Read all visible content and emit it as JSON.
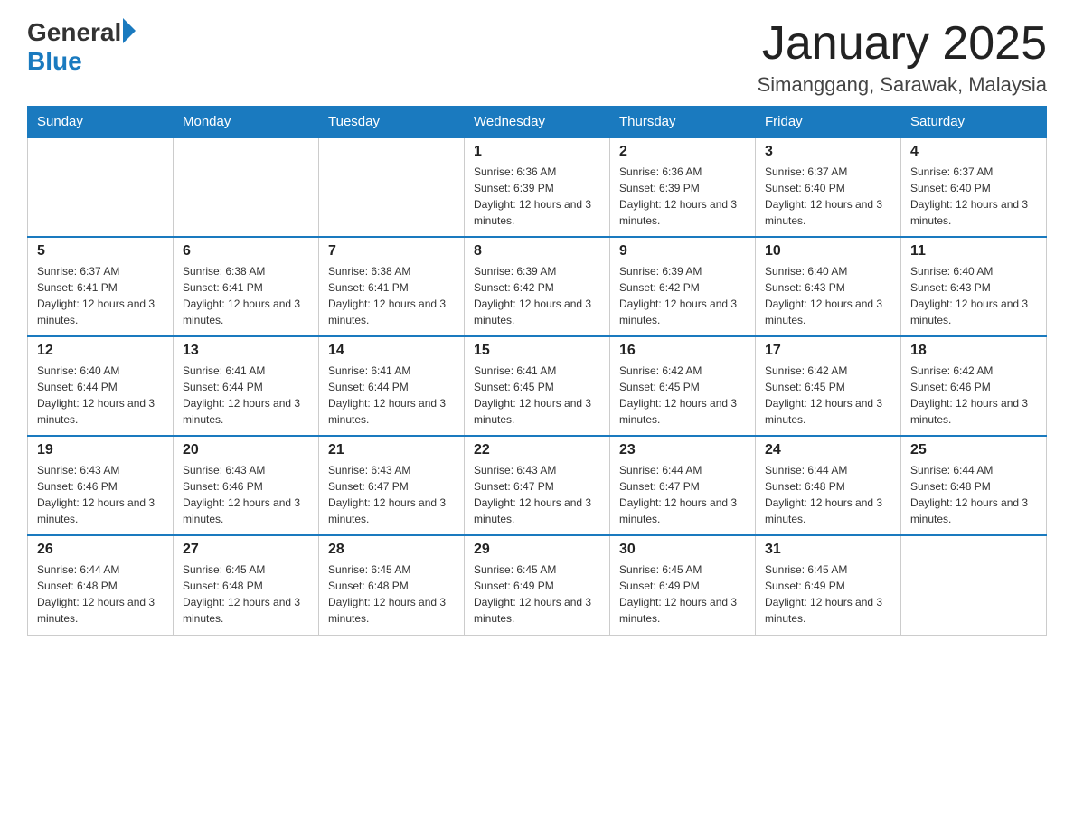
{
  "header": {
    "logo_general": "General",
    "logo_blue": "Blue",
    "title": "January 2025",
    "subtitle": "Simanggang, Sarawak, Malaysia"
  },
  "weekdays": [
    "Sunday",
    "Monday",
    "Tuesday",
    "Wednesday",
    "Thursday",
    "Friday",
    "Saturday"
  ],
  "weeks": [
    [
      {
        "day": "",
        "info": ""
      },
      {
        "day": "",
        "info": ""
      },
      {
        "day": "",
        "info": ""
      },
      {
        "day": "1",
        "info": "Sunrise: 6:36 AM\nSunset: 6:39 PM\nDaylight: 12 hours and 3 minutes."
      },
      {
        "day": "2",
        "info": "Sunrise: 6:36 AM\nSunset: 6:39 PM\nDaylight: 12 hours and 3 minutes."
      },
      {
        "day": "3",
        "info": "Sunrise: 6:37 AM\nSunset: 6:40 PM\nDaylight: 12 hours and 3 minutes."
      },
      {
        "day": "4",
        "info": "Sunrise: 6:37 AM\nSunset: 6:40 PM\nDaylight: 12 hours and 3 minutes."
      }
    ],
    [
      {
        "day": "5",
        "info": "Sunrise: 6:37 AM\nSunset: 6:41 PM\nDaylight: 12 hours and 3 minutes."
      },
      {
        "day": "6",
        "info": "Sunrise: 6:38 AM\nSunset: 6:41 PM\nDaylight: 12 hours and 3 minutes."
      },
      {
        "day": "7",
        "info": "Sunrise: 6:38 AM\nSunset: 6:41 PM\nDaylight: 12 hours and 3 minutes."
      },
      {
        "day": "8",
        "info": "Sunrise: 6:39 AM\nSunset: 6:42 PM\nDaylight: 12 hours and 3 minutes."
      },
      {
        "day": "9",
        "info": "Sunrise: 6:39 AM\nSunset: 6:42 PM\nDaylight: 12 hours and 3 minutes."
      },
      {
        "day": "10",
        "info": "Sunrise: 6:40 AM\nSunset: 6:43 PM\nDaylight: 12 hours and 3 minutes."
      },
      {
        "day": "11",
        "info": "Sunrise: 6:40 AM\nSunset: 6:43 PM\nDaylight: 12 hours and 3 minutes."
      }
    ],
    [
      {
        "day": "12",
        "info": "Sunrise: 6:40 AM\nSunset: 6:44 PM\nDaylight: 12 hours and 3 minutes."
      },
      {
        "day": "13",
        "info": "Sunrise: 6:41 AM\nSunset: 6:44 PM\nDaylight: 12 hours and 3 minutes."
      },
      {
        "day": "14",
        "info": "Sunrise: 6:41 AM\nSunset: 6:44 PM\nDaylight: 12 hours and 3 minutes."
      },
      {
        "day": "15",
        "info": "Sunrise: 6:41 AM\nSunset: 6:45 PM\nDaylight: 12 hours and 3 minutes."
      },
      {
        "day": "16",
        "info": "Sunrise: 6:42 AM\nSunset: 6:45 PM\nDaylight: 12 hours and 3 minutes."
      },
      {
        "day": "17",
        "info": "Sunrise: 6:42 AM\nSunset: 6:45 PM\nDaylight: 12 hours and 3 minutes."
      },
      {
        "day": "18",
        "info": "Sunrise: 6:42 AM\nSunset: 6:46 PM\nDaylight: 12 hours and 3 minutes."
      }
    ],
    [
      {
        "day": "19",
        "info": "Sunrise: 6:43 AM\nSunset: 6:46 PM\nDaylight: 12 hours and 3 minutes."
      },
      {
        "day": "20",
        "info": "Sunrise: 6:43 AM\nSunset: 6:46 PM\nDaylight: 12 hours and 3 minutes."
      },
      {
        "day": "21",
        "info": "Sunrise: 6:43 AM\nSunset: 6:47 PM\nDaylight: 12 hours and 3 minutes."
      },
      {
        "day": "22",
        "info": "Sunrise: 6:43 AM\nSunset: 6:47 PM\nDaylight: 12 hours and 3 minutes."
      },
      {
        "day": "23",
        "info": "Sunrise: 6:44 AM\nSunset: 6:47 PM\nDaylight: 12 hours and 3 minutes."
      },
      {
        "day": "24",
        "info": "Sunrise: 6:44 AM\nSunset: 6:48 PM\nDaylight: 12 hours and 3 minutes."
      },
      {
        "day": "25",
        "info": "Sunrise: 6:44 AM\nSunset: 6:48 PM\nDaylight: 12 hours and 3 minutes."
      }
    ],
    [
      {
        "day": "26",
        "info": "Sunrise: 6:44 AM\nSunset: 6:48 PM\nDaylight: 12 hours and 3 minutes."
      },
      {
        "day": "27",
        "info": "Sunrise: 6:45 AM\nSunset: 6:48 PM\nDaylight: 12 hours and 3 minutes."
      },
      {
        "day": "28",
        "info": "Sunrise: 6:45 AM\nSunset: 6:48 PM\nDaylight: 12 hours and 3 minutes."
      },
      {
        "day": "29",
        "info": "Sunrise: 6:45 AM\nSunset: 6:49 PM\nDaylight: 12 hours and 3 minutes."
      },
      {
        "day": "30",
        "info": "Sunrise: 6:45 AM\nSunset: 6:49 PM\nDaylight: 12 hours and 3 minutes."
      },
      {
        "day": "31",
        "info": "Sunrise: 6:45 AM\nSunset: 6:49 PM\nDaylight: 12 hours and 3 minutes."
      },
      {
        "day": "",
        "info": ""
      }
    ]
  ]
}
